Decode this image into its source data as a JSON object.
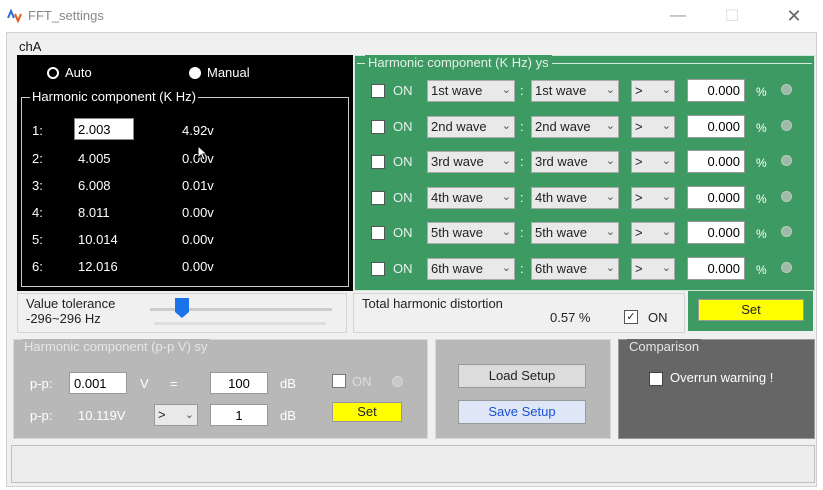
{
  "window": {
    "title": "FFT_settings",
    "minimize": "—",
    "maximize": "☐",
    "close": "✕"
  },
  "channel": "chA",
  "mode": {
    "auto_label": "Auto",
    "manual_label": "Manual",
    "selected": "manual"
  },
  "harmonic_kHz": {
    "legend": "Harmonic component (K Hz)",
    "rows": [
      {
        "idx": "1:",
        "freq": "2.003",
        "amp": "4.92v"
      },
      {
        "idx": "2:",
        "freq": "4.005",
        "amp": "0.00v"
      },
      {
        "idx": "3:",
        "freq": "6.008",
        "amp": "0.01v"
      },
      {
        "idx": "4:",
        "freq": "8.011",
        "amp": "0.00v"
      },
      {
        "idx": "5:",
        "freq": "10.014",
        "amp": "0.00v"
      },
      {
        "idx": "6:",
        "freq": "12.016",
        "amp": "0.00v"
      }
    ]
  },
  "harmonic_ys": {
    "legend": "Harmonic component (K Hz) ys",
    "rows": [
      {
        "on_label": "ON",
        "wave_a": "1st wave",
        "colon": ":",
        "wave_b": "1st wave",
        "op": ">",
        "value": "0.000",
        "unit": "%"
      },
      {
        "on_label": "ON",
        "wave_a": "2nd wave",
        "colon": ":",
        "wave_b": "2nd wave",
        "op": ">",
        "value": "0.000",
        "unit": "%"
      },
      {
        "on_label": "ON",
        "wave_a": "3rd wave",
        "colon": ":",
        "wave_b": "3rd wave",
        "op": ">",
        "value": "0.000",
        "unit": "%"
      },
      {
        "on_label": "ON",
        "wave_a": "4th wave",
        "colon": ":",
        "wave_b": "4th wave",
        "op": ">",
        "value": "0.000",
        "unit": "%"
      },
      {
        "on_label": "ON",
        "wave_a": "5th wave",
        "colon": ":",
        "wave_b": "5th wave",
        "op": ">",
        "value": "0.000",
        "unit": "%"
      },
      {
        "on_label": "ON",
        "wave_a": "6th wave",
        "colon": ":",
        "wave_b": "6th wave",
        "op": ">",
        "value": "0.000",
        "unit": "%"
      }
    ]
  },
  "tolerance": {
    "label": "Value tolerance",
    "range": "-296~296 Hz"
  },
  "thd": {
    "label": "Total harmonic distortion",
    "value": "0.57 %",
    "checked": "✓",
    "on_label": "ON",
    "set_label": "Set"
  },
  "pp": {
    "legend": "Harmonic component (p-p V) sy",
    "row1": {
      "label": "p-p:",
      "input": "0.001",
      "unit": "V",
      "eq": "=",
      "value": "100",
      "db": "dB"
    },
    "row2": {
      "label": "p-p:",
      "reading": "10.119V",
      "op": ">",
      "value": "1",
      "db": "dB"
    },
    "on_label": "ON",
    "set_label": "Set"
  },
  "setup": {
    "load_label": "Load Setup",
    "save_label": "Save Setup"
  },
  "comparison": {
    "legend": "Comparison",
    "overrun_label": "Overrun warning !"
  }
}
